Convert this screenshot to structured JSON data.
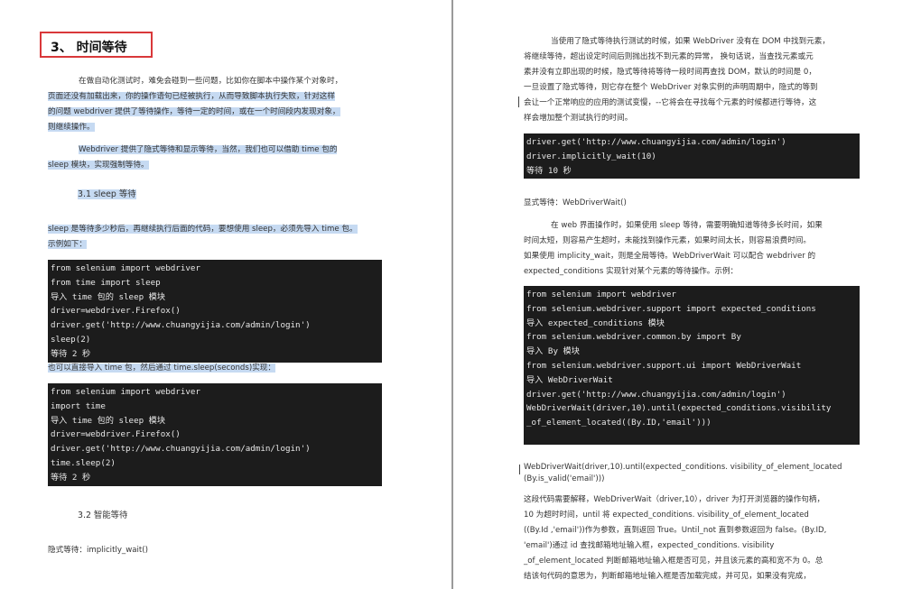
{
  "left_page": {
    "heading": "3、  时间等待",
    "intro": [
      "在做自动化测试时，难免会碰到一些问题，比如你在脚本中操作某个对象时，",
      "页面还没有加载出来，你的操作语句已经被执行，从而导致脚本执行失败，针对这样",
      "的问题 webdriver 提供了等待操作，等待一定的时间，或在一个时间段内发现对象，",
      "则继续操作。"
    ],
    "intro2": [
      "Webdriver 提供了隐式等待和显示等待，当然，我们也可以借助 time 包的",
      "sleep 模块，实现强制等待。"
    ],
    "section_31": "3.1     sleep 等待",
    "sleep_desc": [
      "sleep 是等待多少秒后，再继续执行后面的代码，要想使用 sleep，必须先导入 time 包。",
      "示例如下："
    ],
    "code1": [
      "from selenium import webdriver",
      "from time import sleep",
      "导入 time 包的 sleep 模块",
      "driver=webdriver.Firefox()",
      "driver.get('http://www.chuangyijia.com/admin/login')",
      "sleep(2)",
      "等待 2 秒"
    ],
    "between_text": "也可以直接导入 time 包，然后通过 time.sleep(seconds)实现：",
    "code2": [
      "from selenium import webdriver",
      "import time",
      "导入 time 包的 sleep 模块",
      "driver=webdriver.Firefox()",
      "driver.get('http://www.chuangyijia.com/admin/login')",
      "time.sleep(2)",
      "等待 2 秒"
    ],
    "section_32": "3.2     智能等待",
    "implicit_label": "隐式等待：implicitly_wait()"
  },
  "right_page": {
    "intro": [
      "当使用了隐式等待执行测试的时候，如果 WebDriver 没有在 DOM 中找到元素，",
      "将继续等待，超出设定时间后则抛出找不到元素的异常，  换句话说，当查找元素或元",
      "素并没有立即出现的时候，隐式等待将等待一段时间再查找 DOM，默认的时间是 0，",
      "一旦设置了隐式等待，则它存在整个 WebDriver 对象实例的声明周期中，隐式的等到",
      "会让一个正常响应的应用的测试变慢，--它将会在寻找每个元素的时候都进行等待，这",
      "样会增加整个测试执行的时间。"
    ],
    "code3": [
      "driver.get('http://www.chuangyijia.com/admin/login')",
      "driver.implicitly_wait(10)",
      "等待 10 秒"
    ],
    "explicit_label": "显式等待：WebDriverWait()",
    "explicit_desc": [
      "在 web 界面操作时，如果使用 sleep 等待，需要明确知道等待多长时间，如果",
      "时间太短，则容易产生超时，未能找到操作元素，如果时间太长，则容易浪费时间。",
      "如果使用 implicity_wait，则是全局等待。WebDriverWait 可以配合 webdriver 的",
      "expected_conditions 实现针对某个元素的等待操作。示例："
    ],
    "code4": [
      "from selenium import webdriver",
      "from selenium.webdriver.support import expected_conditions",
      "导入 expected_conditions 模块",
      "from selenium.webdriver.common.by import By",
      "导入 By 模块",
      "from selenium.webdriver.support.ui import WebDriverWait",
      "导入 WebDriverWait",
      "driver.get('http://www.chuangyijia.com/admin/login')",
      "WebDriverWait(driver,10).until(expected_conditions.visibility",
      "_of_element_located((By.ID,'email')))"
    ],
    "wdw_line": [
      "WebDriverWait(driver,10).until(expected_conditions. visibility_of_element_located",
      "(By.is_valid('email')))"
    ],
    "explain": [
      "这段代码需要解释，WebDriverWait（driver,10），driver 为打开浏览器的操作句柄，",
      "10 为超时时间，until 将 expected_conditions. visibility_of_element_located",
      "((By.Id ,'email'))作为参数，直到返回 True。Until_not 直到参数返回为 false。(By.ID,",
      "'email')通过 id 查找邮箱地址输入框，expected_conditions. visibility",
      "_of_element_located 判断邮箱地址输入框是否可见，并且该元素的高和宽不为 0。总",
      "结该句代码的意思为，判断邮箱地址输入框是否加载完成，并可见，如果没有完成，"
    ]
  }
}
